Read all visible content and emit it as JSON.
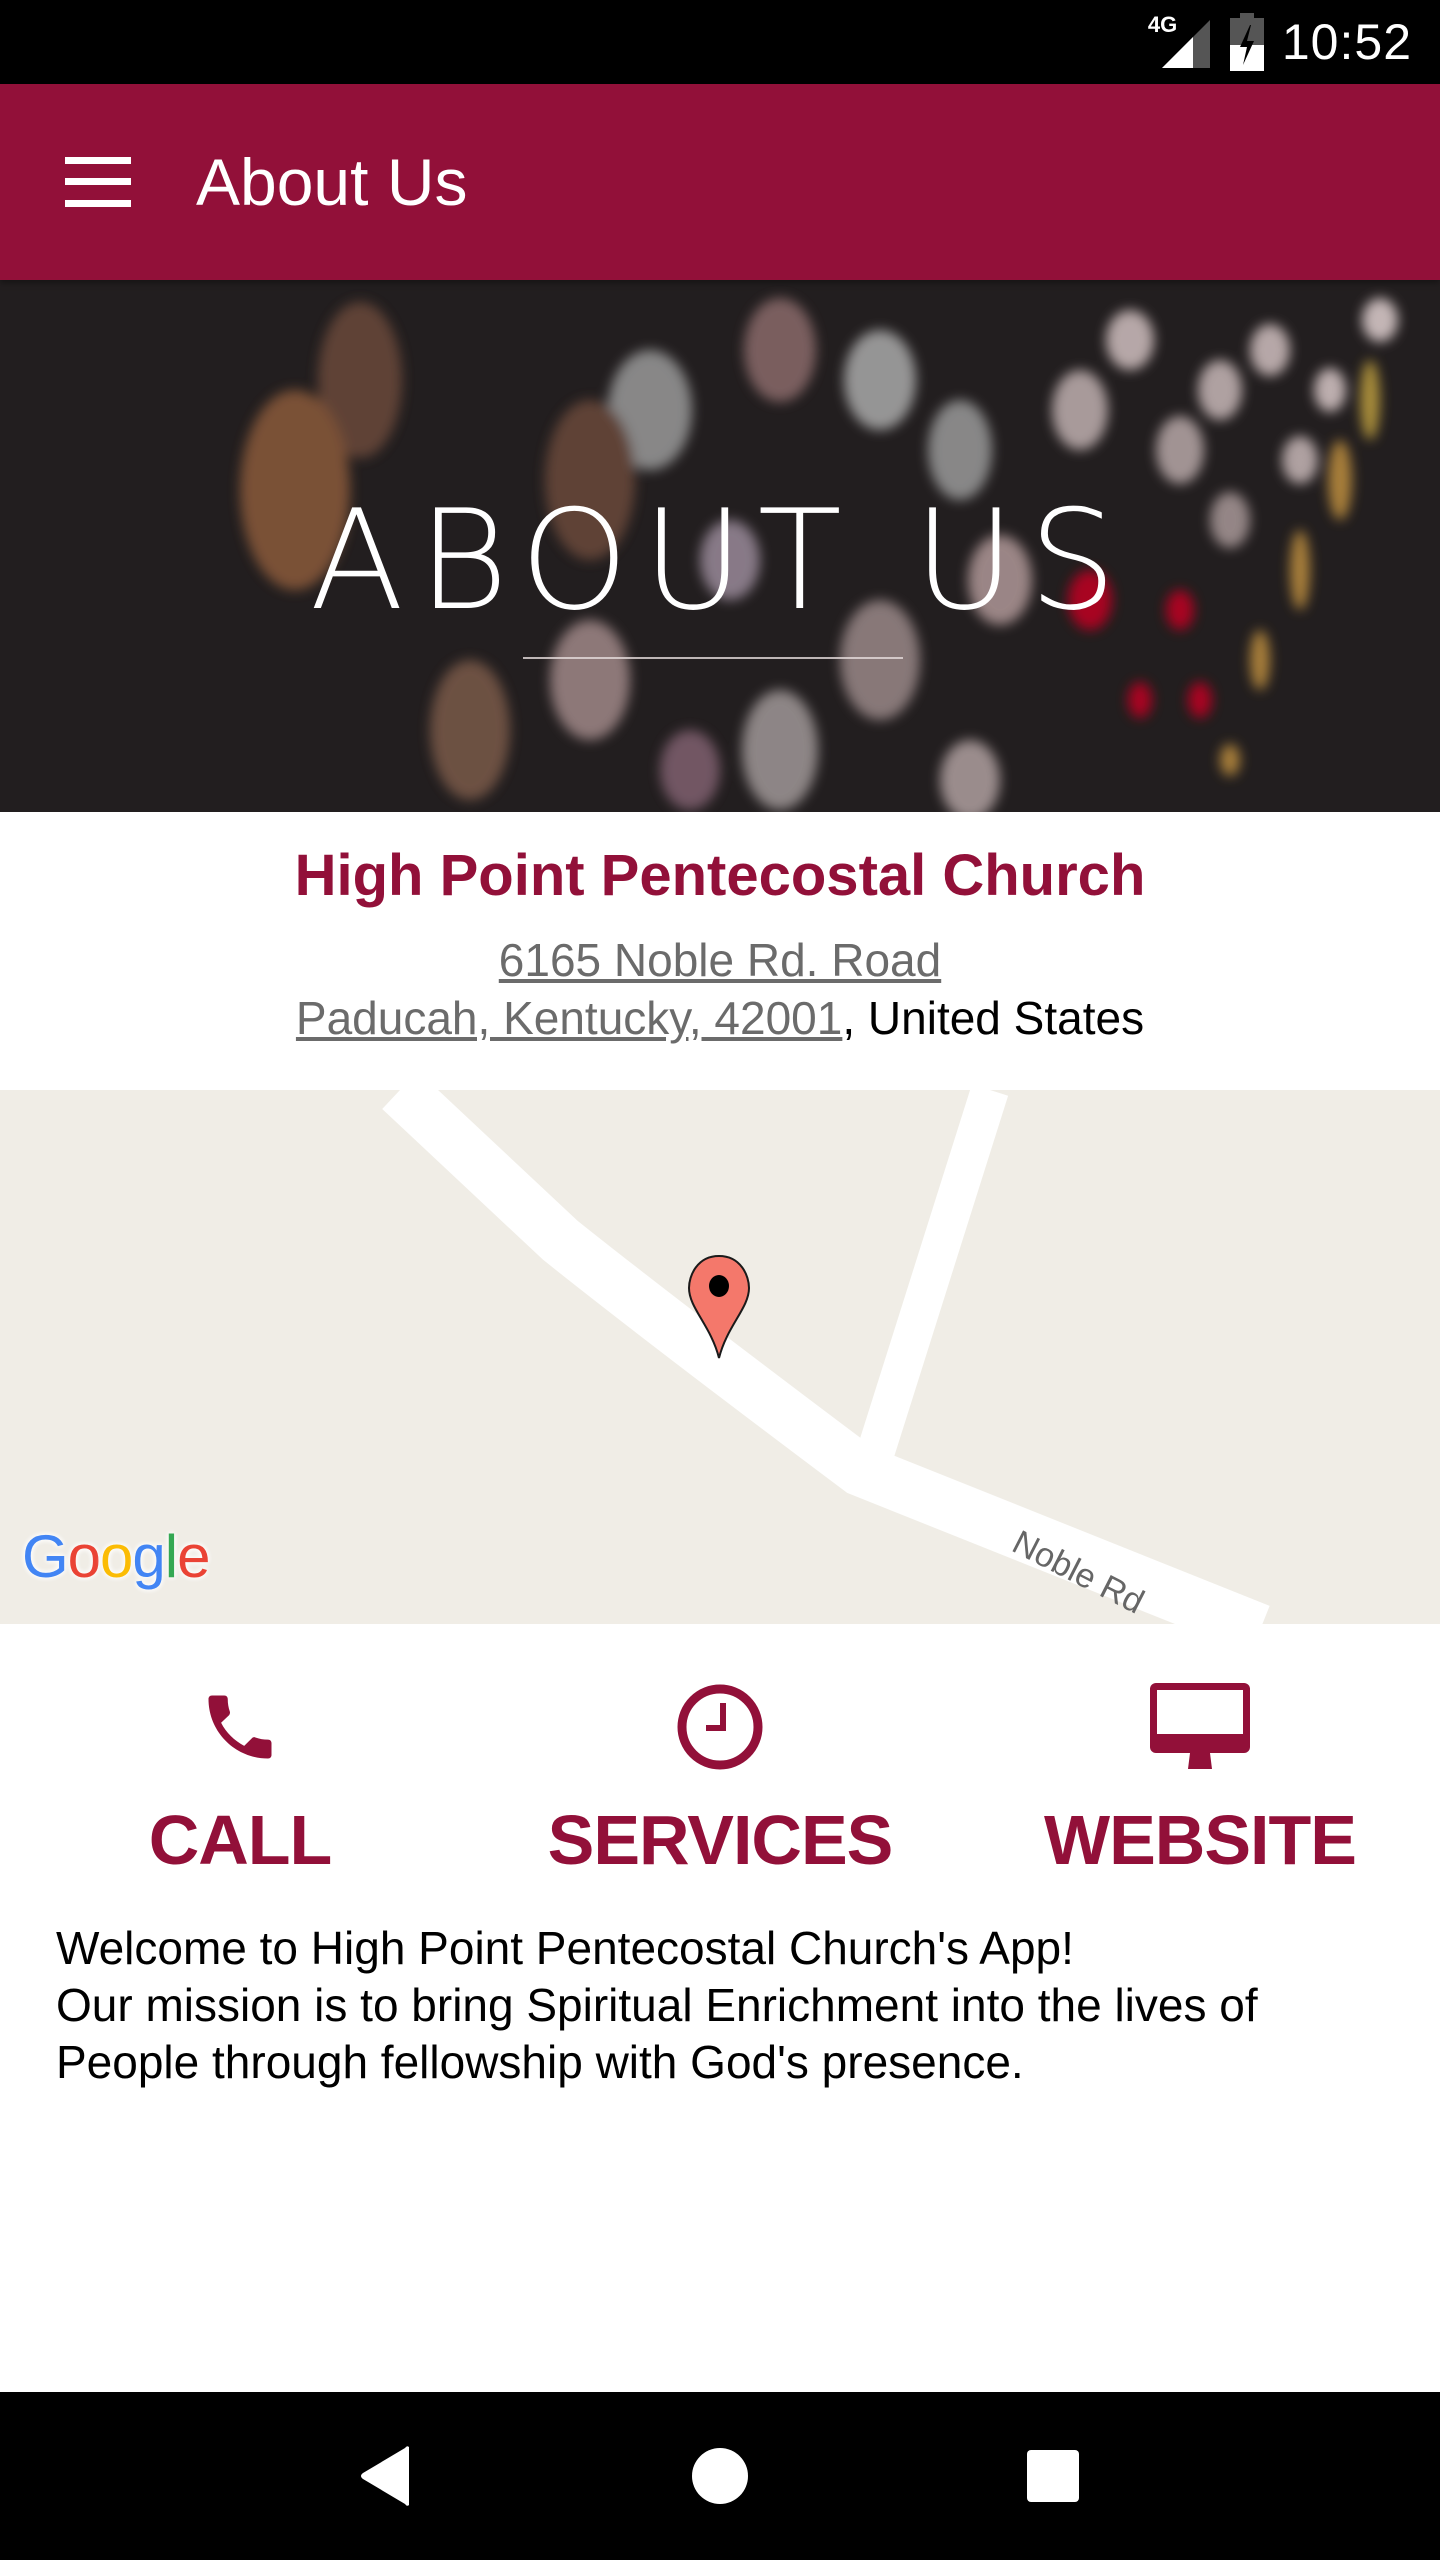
{
  "status_bar": {
    "network": "4G",
    "time": "10:52",
    "icons": [
      "signal-icon",
      "battery-charging-icon"
    ]
  },
  "app_bar": {
    "menu_icon": "hamburger-menu-icon",
    "title": "About Us"
  },
  "hero": {
    "title": "ABOUT US"
  },
  "church": {
    "name": "High Point Pentecostal Church",
    "address_line1": "6165 Noble Rd. Road",
    "address_line2": "Paducah, Kentucky, 42001",
    "country_suffix": ", United States"
  },
  "map": {
    "road_label": "Noble Rd",
    "logo_text": "Google",
    "marker_icon": "map-pin-icon"
  },
  "actions": [
    {
      "label": "CALL",
      "icon": "phone-icon"
    },
    {
      "label": "SERVICES",
      "icon": "clock-icon"
    },
    {
      "label": "WEBSITE",
      "icon": "monitor-icon"
    }
  ],
  "welcome": {
    "line1": "Welcome to High Point Pentecostal Church's App!",
    "line2": "Our mission is to bring Spiritual Enrichment into the lives of People through fellowship with God's presence."
  },
  "nav_bar": {
    "back": "back-icon",
    "home": "home-icon",
    "recents": "recents-icon"
  },
  "colors": {
    "brand": "#921039",
    "map_bg": "#f0ede6"
  }
}
